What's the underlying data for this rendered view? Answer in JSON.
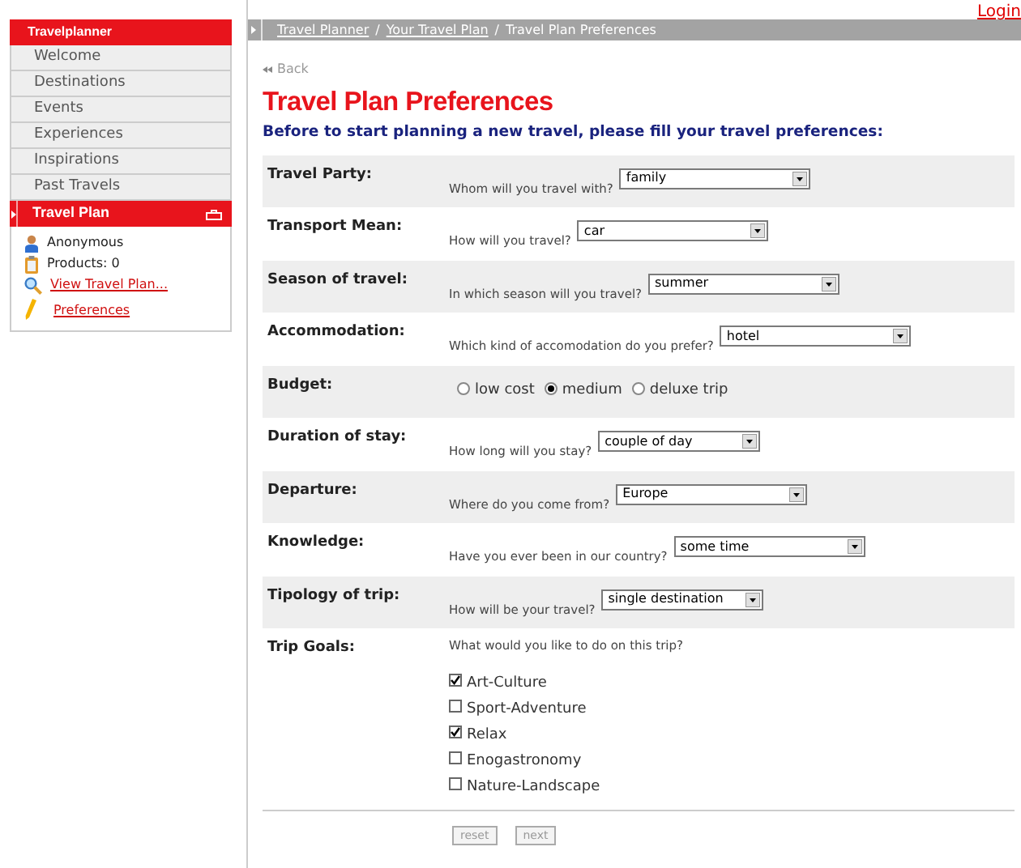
{
  "top_link": "Login",
  "sidebar": {
    "title": "Travelplanner",
    "items": [
      {
        "label": "Welcome"
      },
      {
        "label": "Destinations"
      },
      {
        "label": "Events"
      },
      {
        "label": "Experiences"
      },
      {
        "label": "Inspirations"
      },
      {
        "label": "Past Travels"
      }
    ],
    "plan": {
      "title": "Travel Plan",
      "entries": [
        {
          "kind": "user",
          "label": "Anonymous"
        },
        {
          "kind": "products",
          "label": "Products: 0"
        },
        {
          "kind": "view",
          "label": "View Travel Plan..."
        },
        {
          "kind": "prefs",
          "label": "Preferences"
        }
      ]
    }
  },
  "breadcrumb_separator": "/",
  "breadcrumb": [
    {
      "label": "Travel Planner",
      "link": true
    },
    {
      "label": "Your Travel Plan",
      "link": true
    },
    {
      "label": "Travel Plan Preferences",
      "link": false
    }
  ],
  "back": "Back",
  "title": "Travel Plan Preferences",
  "intro": "Before to start planning a new travel, please fill your travel preferences:",
  "rows": [
    {
      "kind": "select",
      "label": "Travel Party:",
      "question": "Whom will you travel with?",
      "value": "family"
    },
    {
      "kind": "select",
      "label": "Transport Mean:",
      "question": "How will you travel?",
      "value": "car"
    },
    {
      "kind": "select",
      "label": "Season of travel:",
      "question": "In which season will you travel?",
      "value": "summer"
    },
    {
      "kind": "select",
      "label": "Accommodation:",
      "question": "Which kind of accomodation do you prefer?",
      "value": "hotel"
    },
    {
      "kind": "radio",
      "label": "Budget:",
      "options": [
        {
          "label": "low cost",
          "selected": false
        },
        {
          "label": "medium",
          "selected": true
        },
        {
          "label": "deluxe trip",
          "selected": false
        }
      ]
    },
    {
      "kind": "select",
      "label": "Duration of stay:",
      "question": "How long will you stay?",
      "value": "couple of day"
    },
    {
      "kind": "select",
      "label": "Departure:",
      "question": "Where do you come from?",
      "value": "Europe"
    },
    {
      "kind": "select",
      "label": "Knowledge:",
      "question": "Have you ever been in our country?",
      "value": "some time"
    },
    {
      "kind": "select",
      "label": "Tipology of trip:",
      "question": "How will be your travel?",
      "value": "single destination"
    },
    {
      "kind": "checkboxes",
      "label": "Trip Goals:",
      "question": "What would you like to do on this trip?",
      "options": [
        {
          "label": "Art-Culture",
          "checked": true
        },
        {
          "label": "Sport-Adventure",
          "checked": false
        },
        {
          "label": "Relax",
          "checked": true
        },
        {
          "label": "Enogastronomy",
          "checked": false
        },
        {
          "label": "Nature-Landscape",
          "checked": false
        }
      ]
    }
  ],
  "buttons": [
    "reset",
    "next"
  ]
}
